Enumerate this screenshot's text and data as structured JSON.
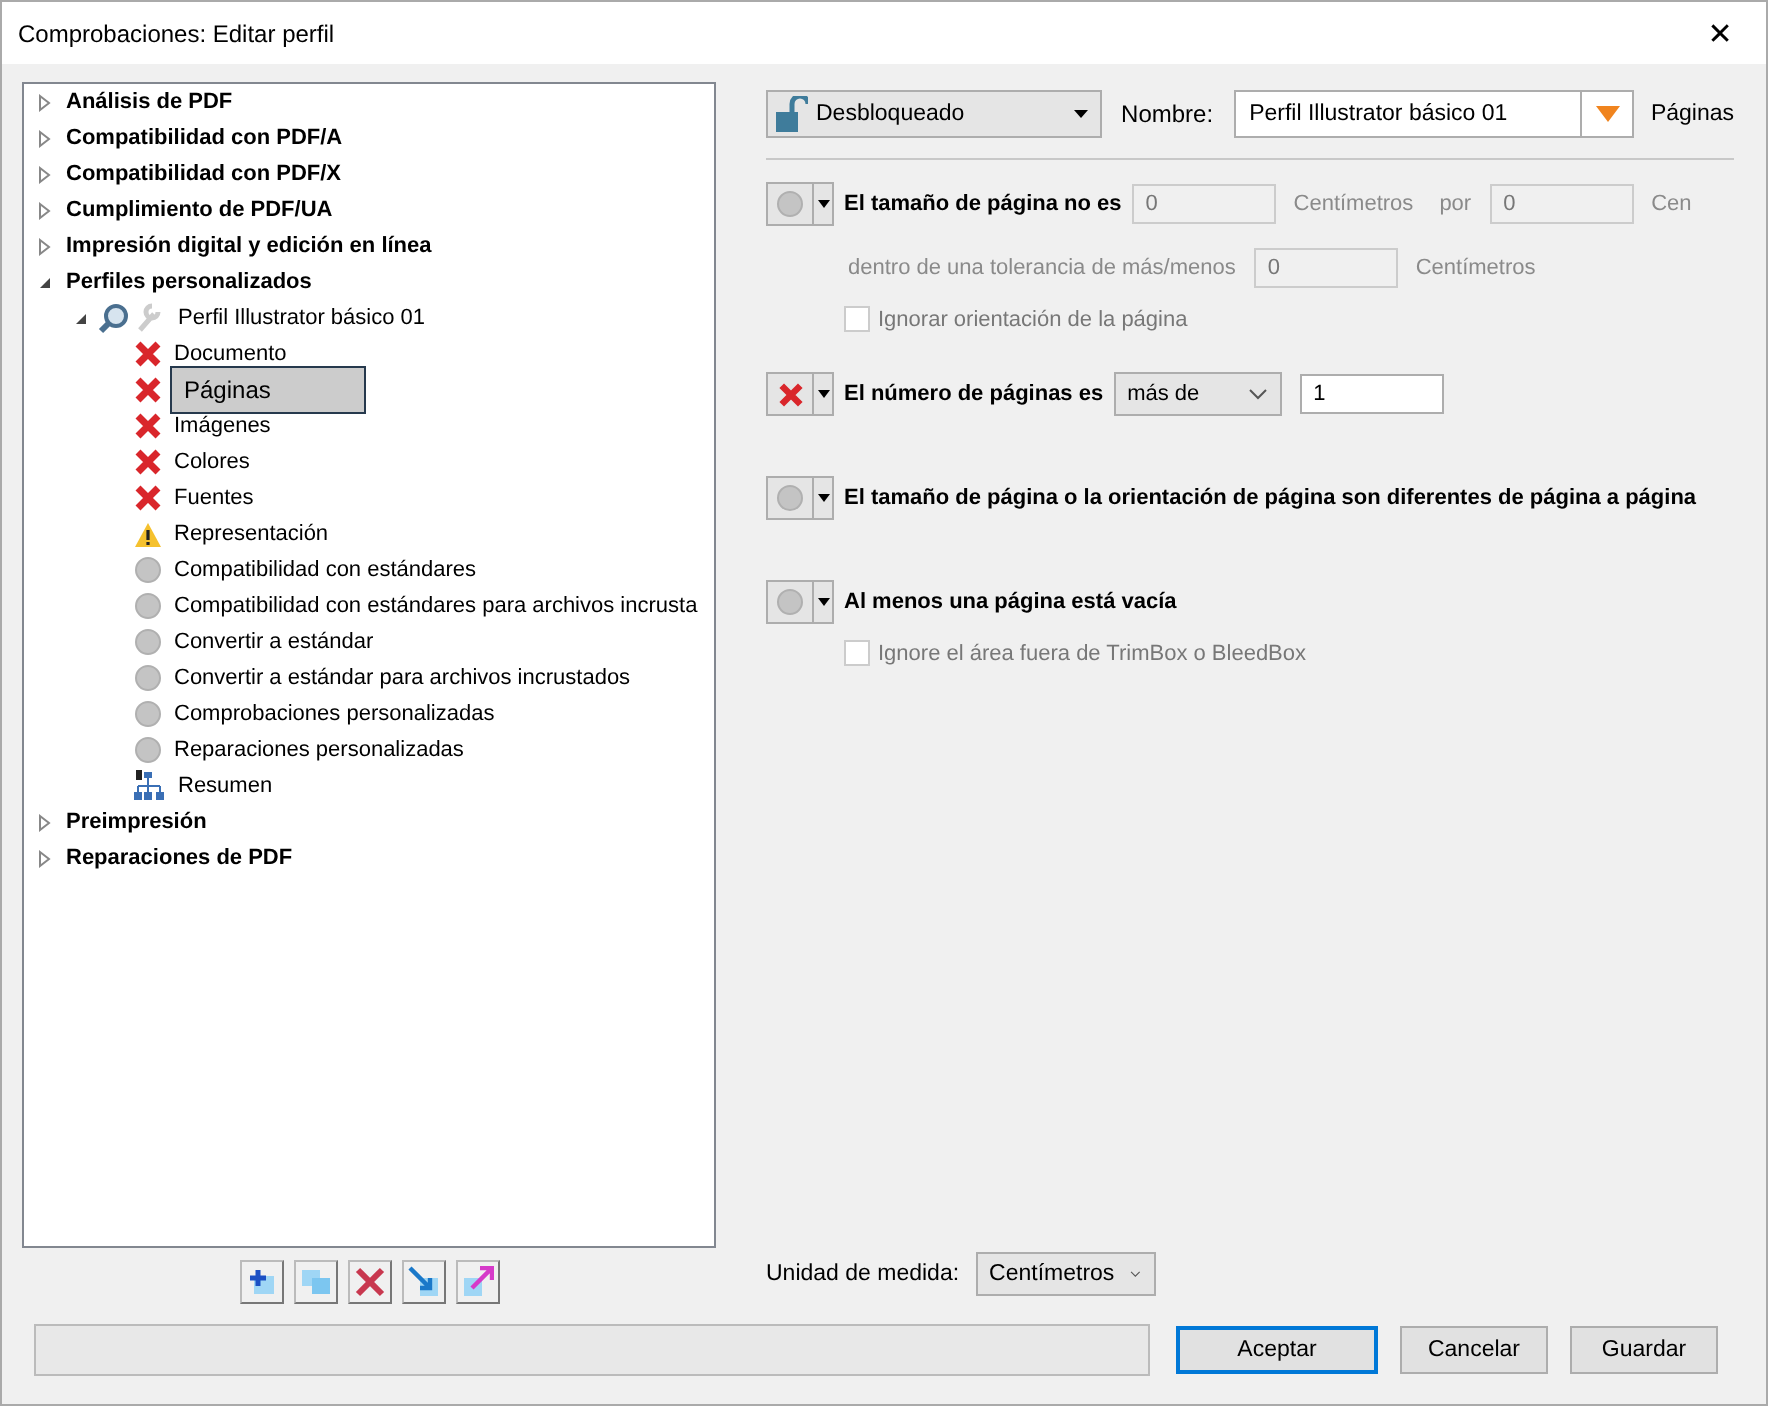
{
  "window": {
    "title": "Comprobaciones: Editar perfil",
    "close": "✕"
  },
  "tree": [
    {
      "label": "Análisis de PDF",
      "expanded": false,
      "selected": false
    },
    {
      "label": "Compatibilidad con PDF/A",
      "expanded": false,
      "selected": false
    },
    {
      "label": "Compatibilidad con PDF/X",
      "expanded": false,
      "selected": false
    },
    {
      "label": "Cumplimiento de PDF/UA",
      "expanded": false,
      "selected": false
    },
    {
      "label": "Impresión digital y edición en línea",
      "expanded": false,
      "selected": false
    },
    {
      "label": "Perfiles personalizados",
      "expanded": true,
      "selected": false,
      "children": [
        {
          "label": "Perfil Illustrator básico 01",
          "expanded": true,
          "selected": false,
          "kind": "profile",
          "children": [
            {
              "label": "Documento",
              "kind": "error",
              "selected": false
            },
            {
              "label": "Páginas",
              "kind": "error",
              "selected": true
            },
            {
              "label": "Imágenes",
              "kind": "error",
              "selected": false
            },
            {
              "label": "Colores",
              "kind": "error",
              "selected": false
            },
            {
              "label": "Fuentes",
              "kind": "error",
              "selected": false
            },
            {
              "label": "Representación",
              "kind": "warning",
              "selected": false
            },
            {
              "label": "Compatibilidad con estándares",
              "kind": "none",
              "selected": false
            },
            {
              "label": "Compatibilidad con estándares para archivos incrusta",
              "kind": "none",
              "selected": false
            },
            {
              "label": "Convertir a estándar",
              "kind": "none",
              "selected": false
            },
            {
              "label": "Convertir a estándar para archivos incrustados",
              "kind": "none",
              "selected": false
            },
            {
              "label": "Comprobaciones personalizadas",
              "kind": "none",
              "selected": false
            },
            {
              "label": "Reparaciones personalizadas",
              "kind": "none",
              "selected": false
            },
            {
              "label": "Resumen",
              "kind": "summary",
              "selected": false
            }
          ]
        }
      ]
    },
    {
      "label": "Preimpresión",
      "expanded": false,
      "selected": false
    },
    {
      "label": "Reparaciones de PDF",
      "expanded": false,
      "selected": false
    }
  ],
  "tree_tools": [
    {
      "kind": "new"
    },
    {
      "kind": "duplicate"
    },
    {
      "kind": "delete"
    },
    {
      "kind": "import"
    },
    {
      "kind": "export"
    }
  ],
  "header": {
    "lock": "Desbloqueado",
    "name_label": "Nombre:",
    "name_value": "Perfil Illustrator básico 01",
    "section": "Páginas"
  },
  "checks": [
    {
      "kind": "none",
      "label": "El tamaño de página no es",
      "disabled": true,
      "items": [
        {
          "kind": "field",
          "value": "0"
        },
        {
          "kind": "text",
          "text": "Centímetros"
        },
        {
          "kind": "text",
          "text": "por"
        },
        {
          "kind": "field",
          "value": "0"
        },
        {
          "kind": "text",
          "text": "Cen"
        }
      ],
      "lines": [
        [
          {
            "kind": "text",
            "text": "dentro de una tolerancia de más/menos"
          },
          {
            "kind": "field",
            "value": "0"
          },
          {
            "kind": "text",
            "text": "Centímetros"
          }
        ]
      ],
      "options": [
        {
          "label": "Ignorar orientación de la página",
          "checked": false,
          "disabled": true
        }
      ]
    },
    {
      "kind": "error",
      "label": "El número de páginas es",
      "disabled": false,
      "items": [
        {
          "kind": "select",
          "value": "más de"
        },
        {
          "kind": "field",
          "value": "1"
        }
      ]
    },
    {
      "kind": "none",
      "label": "El tamaño de página o la orientación de página son diferentes de página a página"
    },
    {
      "kind": "none",
      "label": "Al menos una página está vacía",
      "options": [
        {
          "label": "Ignore el área fuera de TrimBox o BleedBox",
          "checked": false,
          "disabled": true
        }
      ]
    }
  ],
  "unit": {
    "label": "Unidad de medida:",
    "value": "Centímetros"
  },
  "buttons": [
    {
      "label": "Aceptar",
      "default": true
    },
    {
      "label": "Cancelar",
      "default": false
    },
    {
      "label": "Guardar",
      "default": false
    }
  ]
}
